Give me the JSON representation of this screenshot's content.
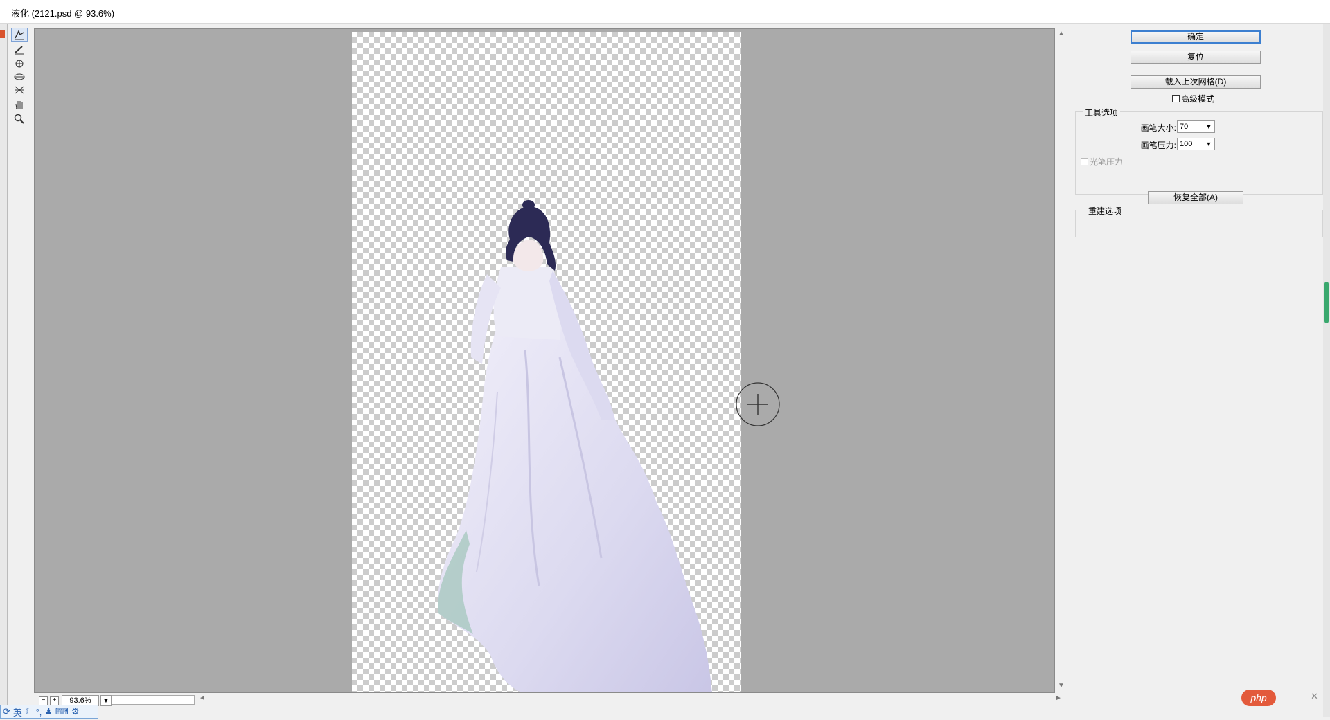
{
  "window": {
    "title": "液化 (2121.psd @ 93.6%)"
  },
  "tools": [
    {
      "name": "forward-warp-tool",
      "icon": "finger-warp-icon",
      "active": true
    },
    {
      "name": "reconstruct-tool",
      "icon": "brush-reconstruct-icon",
      "active": false
    },
    {
      "name": "pucker-tool",
      "icon": "pucker-icon",
      "active": false
    },
    {
      "name": "bloat-tool",
      "icon": "bloat-icon",
      "active": false
    },
    {
      "name": "push-left-tool",
      "icon": "push-left-icon",
      "active": false
    },
    {
      "name": "hand-tool",
      "icon": "hand-icon",
      "active": false
    },
    {
      "name": "zoom-tool",
      "icon": "magnifier-icon",
      "active": false
    }
  ],
  "panel": {
    "ok_label": "确定",
    "reset_label": "复位",
    "load_mesh_label": "载入上次网格(D)",
    "advanced_mode_label": "高级模式",
    "advanced_mode_checked": false,
    "tool_options": {
      "legend": "工具选项",
      "brush_size_label": "画笔大小:",
      "brush_size_value": "70",
      "brush_pressure_label": "画笔压力:",
      "brush_pressure_value": "100",
      "stylus_pressure_label": "光笔压力",
      "stylus_pressure_checked": false
    },
    "reconstruct_options": {
      "legend": "重建选项",
      "restore_all_label": "恢复全部(A)"
    }
  },
  "zoom": {
    "value": "93.6%"
  },
  "ime": {
    "lang": "英"
  },
  "brand": {
    "text": "php"
  },
  "colors": {
    "canvas_bg": "#aaaaaa",
    "default_button_border": "#3c7fd0",
    "dress": "#e4e2f2",
    "hair": "#2c2a55"
  }
}
